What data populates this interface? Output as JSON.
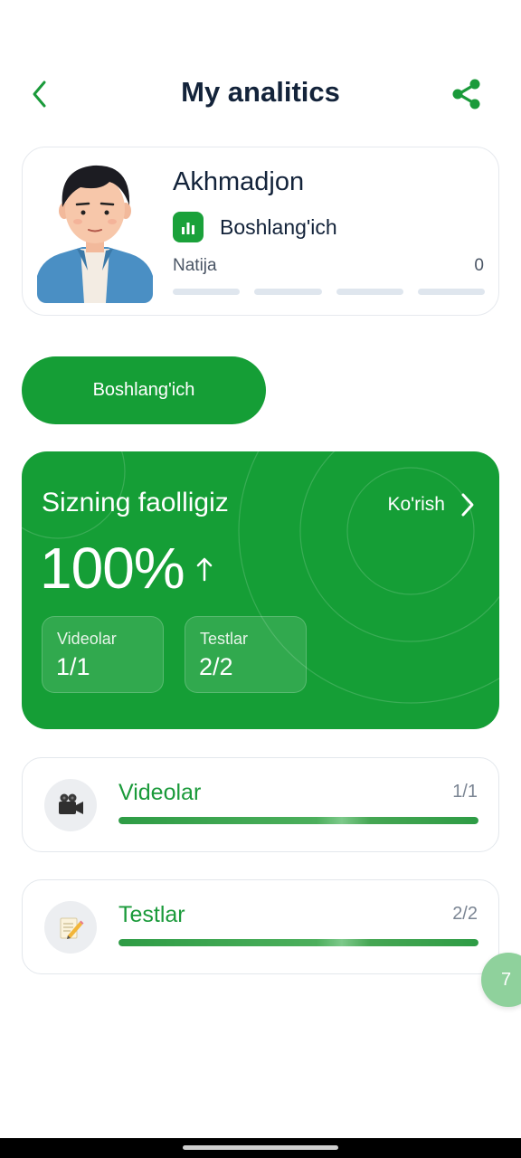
{
  "header": {
    "title": "My analitics",
    "back_icon": "chevron-left-icon",
    "share_icon": "share-icon"
  },
  "profile": {
    "name": "Akhmadjon",
    "level": "Boshlang'ich",
    "result_label": "Natija",
    "result_value": "0",
    "result_segments": 4,
    "level_icon": "bar-chart-icon"
  },
  "level_button": {
    "label": "Boshlang'ich"
  },
  "activity": {
    "title": "Sizning faolligiz",
    "view_label": "Ko'rish",
    "percent": "100%",
    "trend_icon": "arrow-up-icon",
    "stats": [
      {
        "label": "Videolar",
        "value": "1/1"
      },
      {
        "label": "Testlar",
        "value": "2/2"
      }
    ]
  },
  "progress": [
    {
      "title": "Videolar",
      "count": "1/1",
      "progress": 1.0,
      "icon": "video-camera-icon"
    },
    {
      "title": "Testlar",
      "count": "2/2",
      "progress": 1.0,
      "icon": "memo-icon"
    }
  ],
  "floating_badge": {
    "label": "7"
  },
  "colors": {
    "accent": "#159e36",
    "text": "#13233a",
    "track": "#dfe6ee"
  }
}
